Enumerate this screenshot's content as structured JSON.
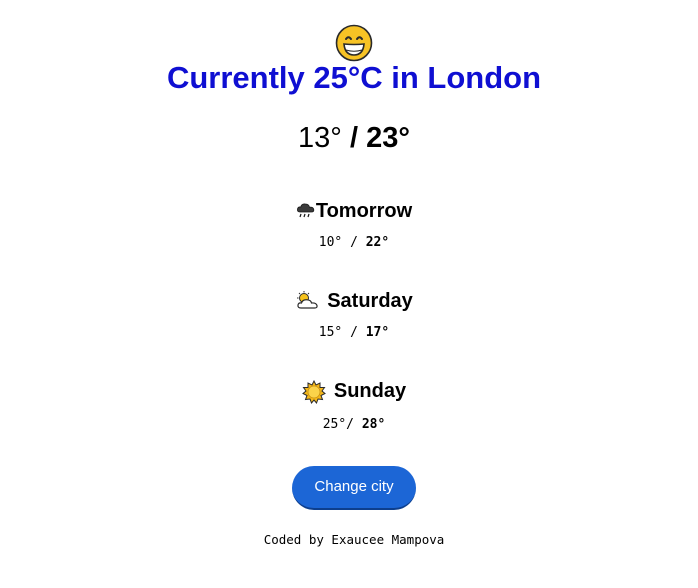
{
  "current": {
    "emoji": "grinning-face-icon",
    "title": "Currently 25°C in London",
    "low": "13°",
    "separator": " / ",
    "high": "23°"
  },
  "forecast": [
    {
      "day": "Tomorrow",
      "icon": "rain-cloud-icon",
      "low": "10°",
      "separator": " / ",
      "high": "22°"
    },
    {
      "day": "Saturday",
      "icon": "sun-behind-cloud-icon",
      "low": "15°",
      "separator": " / ",
      "high": "17°"
    },
    {
      "day": "Sunday",
      "icon": "sun-icon",
      "low": "25°",
      "separator": "/ ",
      "high": "28°"
    }
  ],
  "button": {
    "label": "Change city"
  },
  "footer": {
    "text": "Coded by Exaucee Mampova"
  },
  "colors": {
    "title": "#0f0fd2",
    "button": "#1c66d6",
    "text": "#000000"
  }
}
